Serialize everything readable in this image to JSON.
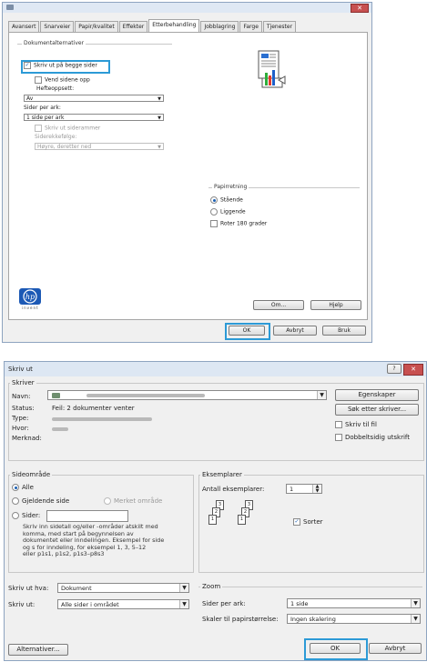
{
  "dlg1": {
    "tabs": [
      "Avansert",
      "Snarveier",
      "Papir/kvalitet",
      "Effekter",
      "Etterbehandling",
      "Jobblagring",
      "Farge",
      "Tjenester"
    ],
    "active_tab": "Etterbehandling",
    "doc_group_label": "Dokumentalternativer",
    "print_both_label": "Skriv ut på begge sider",
    "flip_label": "Vend sidene opp",
    "booklet_label": "Hefteoppsett:",
    "booklet_value": "Av",
    "pages_per_sheet_label": "Sider per ark:",
    "pages_per_sheet_value": "1 side per ark",
    "page_borders_label": "Skriv ut siderammer",
    "page_order_label": "Siderekkefølge:",
    "page_order_value": "Høyre, deretter ned",
    "orientation_label": "Papirretning",
    "portrait_label": "Stående",
    "landscape_label": "Liggende",
    "rotate_label": "Roter 180 grader",
    "logo_text": "invent",
    "about_label": "Om...",
    "help_label": "Hjelp",
    "ok_label": "OK",
    "cancel_label": "Avbryt",
    "apply_label": "Bruk"
  },
  "dlg2": {
    "title": "Skriv ut",
    "help_glyph": "?",
    "close_glyph": "✕",
    "printer_group": "Skriver",
    "name_label": "Navn:",
    "status_label": "Status:",
    "status_value": "Feil: 2 dokumenter venter",
    "type_label": "Type:",
    "where_label": "Hvor:",
    "comment_label": "Merknad:",
    "properties_label": "Egenskaper",
    "find_printer_label": "Søk etter skriver...",
    "print_to_file_label": "Skriv til fil",
    "manual_duplex_label": "Dobbeltsidig utskrift",
    "page_range_group": "Sideområde",
    "all_label": "Alle",
    "current_page_label": "Gjeldende side",
    "selection_label": "Merket område",
    "pages_label": "Sider:",
    "pages_help": [
      "Skriv inn sidetall og/eller -områder atskilt med",
      "komma, med start på begynnelsen av",
      "dokumentet eller inndelingen. Eksempel for side",
      "og s for inndeling, for eksempel 1, 3, 5–12",
      "eller p1s1, p1s2, p1s3–p8s3"
    ],
    "copies_group": "Eksemplarer",
    "copies_label": "Antall eksemplarer:",
    "copies_value": "1",
    "collate_label": "Sorter",
    "print_what_label": "Skriv ut hva:",
    "print_what_value": "Dokument",
    "print_label": "Skriv ut:",
    "print_value": "Alle sider i området",
    "zoom_group": "Zoom",
    "pps_label": "Sider per ark:",
    "pps_value": "1 side",
    "scale_label": "Skaler til papirstørrelse:",
    "scale_value": "Ingen skalering",
    "options_label": "Alternativer...",
    "ok_label": "OK",
    "cancel_label": "Avbryt"
  }
}
